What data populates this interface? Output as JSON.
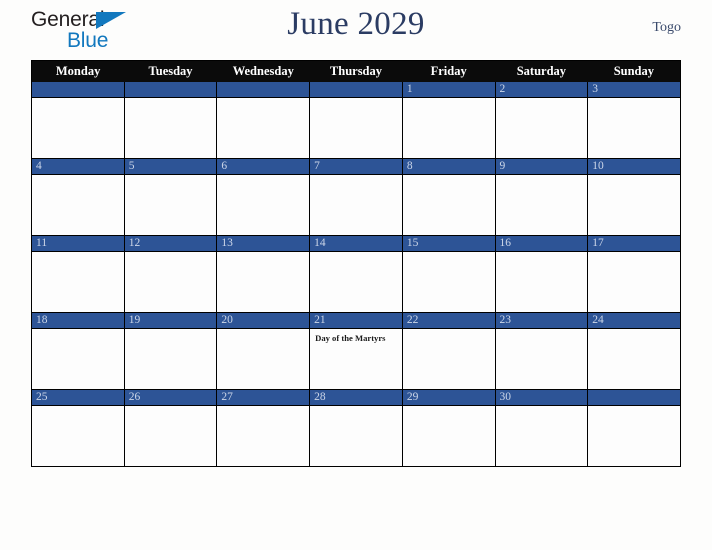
{
  "brand": {
    "word_one": "General",
    "word_two": "Blue",
    "triangle_icon": "triangle-icon",
    "primary_color": "#1278be"
  },
  "header": {
    "title": "June 2029",
    "country": "Togo",
    "title_color": "#2b3c63"
  },
  "calendar": {
    "accent_color": "#2d5496",
    "header_background": "#0b0b0b",
    "weekday_headers": [
      "Monday",
      "Tuesday",
      "Wednesday",
      "Thursday",
      "Friday",
      "Saturday",
      "Sunday"
    ],
    "weeks": [
      [
        {
          "date": "",
          "holiday": ""
        },
        {
          "date": "",
          "holiday": ""
        },
        {
          "date": "",
          "holiday": ""
        },
        {
          "date": "",
          "holiday": ""
        },
        {
          "date": "1",
          "holiday": ""
        },
        {
          "date": "2",
          "holiday": ""
        },
        {
          "date": "3",
          "holiday": ""
        }
      ],
      [
        {
          "date": "4",
          "holiday": ""
        },
        {
          "date": "5",
          "holiday": ""
        },
        {
          "date": "6",
          "holiday": ""
        },
        {
          "date": "7",
          "holiday": ""
        },
        {
          "date": "8",
          "holiday": ""
        },
        {
          "date": "9",
          "holiday": ""
        },
        {
          "date": "10",
          "holiday": ""
        }
      ],
      [
        {
          "date": "11",
          "holiday": ""
        },
        {
          "date": "12",
          "holiday": ""
        },
        {
          "date": "13",
          "holiday": ""
        },
        {
          "date": "14",
          "holiday": ""
        },
        {
          "date": "15",
          "holiday": ""
        },
        {
          "date": "16",
          "holiday": ""
        },
        {
          "date": "17",
          "holiday": ""
        }
      ],
      [
        {
          "date": "18",
          "holiday": ""
        },
        {
          "date": "19",
          "holiday": ""
        },
        {
          "date": "20",
          "holiday": ""
        },
        {
          "date": "21",
          "holiday": "Day of the Martyrs"
        },
        {
          "date": "22",
          "holiday": ""
        },
        {
          "date": "23",
          "holiday": ""
        },
        {
          "date": "24",
          "holiday": ""
        }
      ],
      [
        {
          "date": "25",
          "holiday": ""
        },
        {
          "date": "26",
          "holiday": ""
        },
        {
          "date": "27",
          "holiday": ""
        },
        {
          "date": "28",
          "holiday": ""
        },
        {
          "date": "29",
          "holiday": ""
        },
        {
          "date": "30",
          "holiday": ""
        },
        {
          "date": "",
          "holiday": ""
        }
      ]
    ]
  }
}
